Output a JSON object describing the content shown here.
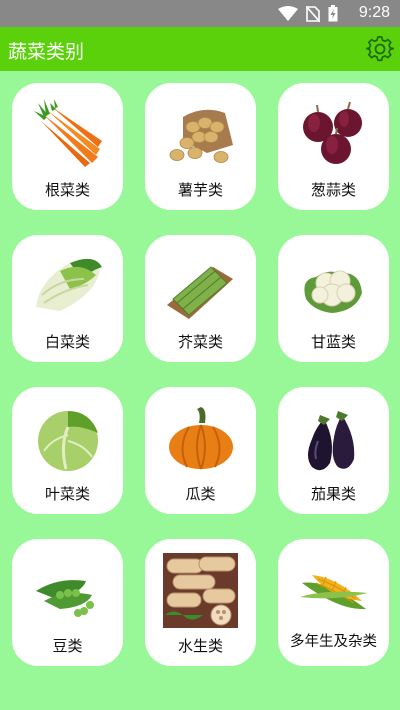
{
  "status_bar": {
    "time": "9:28",
    "icons": [
      "wifi-icon",
      "no-sim-icon",
      "battery-charging-icon"
    ]
  },
  "app_bar": {
    "title": "蔬菜类别",
    "settings_icon": "gear-icon"
  },
  "categories": [
    {
      "label": "根菜类",
      "icon": "carrot-icon"
    },
    {
      "label": "薯芋类",
      "icon": "potato-icon"
    },
    {
      "label": "葱蒜类",
      "icon": "onion-icon"
    },
    {
      "label": "白菜类",
      "icon": "chinese-cabbage-icon"
    },
    {
      "label": "芥菜类",
      "icon": "mustard-greens-icon"
    },
    {
      "label": "甘蓝类",
      "icon": "cauliflower-icon"
    },
    {
      "label": "叶菜类",
      "icon": "lettuce-icon"
    },
    {
      "label": "瓜类",
      "icon": "pumpkin-icon"
    },
    {
      "label": "茄果类",
      "icon": "eggplant-icon"
    },
    {
      "label": "豆类",
      "icon": "pea-icon"
    },
    {
      "label": "水生类",
      "icon": "lotus-root-icon"
    },
    {
      "label": "多年生及杂类",
      "icon": "corn-icon"
    }
  ]
}
